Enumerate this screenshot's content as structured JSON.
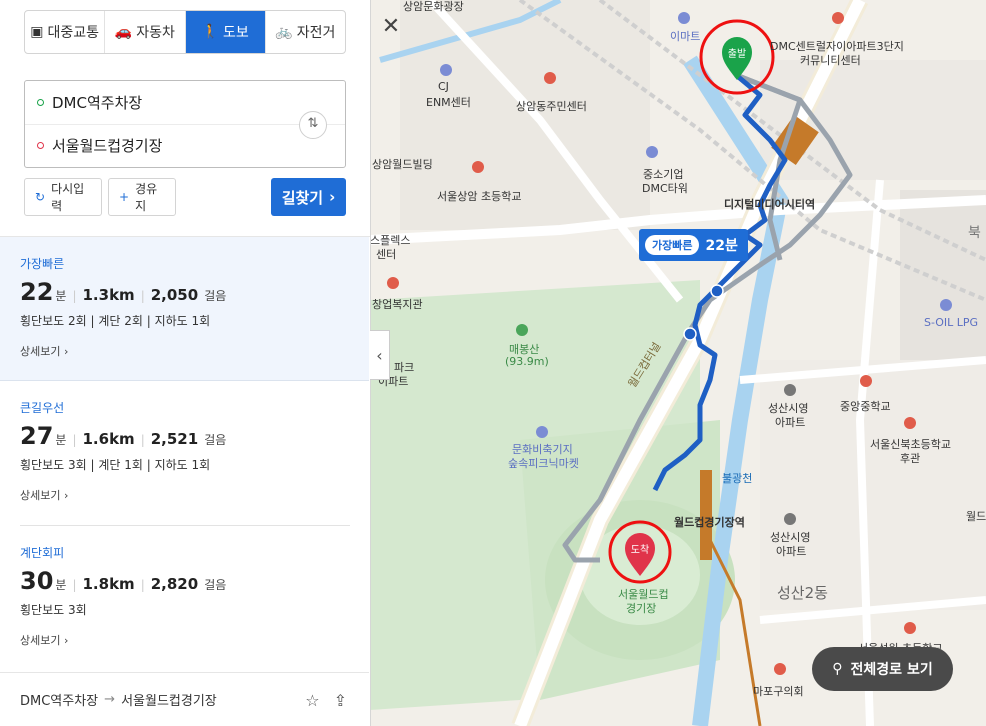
{
  "modes": [
    {
      "label": "대중교통",
      "icon": "bus-icon"
    },
    {
      "label": "자동차",
      "icon": "car-icon"
    },
    {
      "label": "도보",
      "icon": "walk-icon",
      "active": true
    },
    {
      "label": "자전거",
      "icon": "bicycle-icon"
    }
  ],
  "search": {
    "origin": "DMC역주차장",
    "destination": "서울월드컵경기장",
    "reset_label": "다시입력",
    "waypoint_label": "경유지",
    "go_label": "길찾기"
  },
  "routes": [
    {
      "label": "가장빠른",
      "minutes": "22",
      "min_unit": "분",
      "distance": "1.3km",
      "steps": "2,050",
      "steps_unit": "걸음",
      "detail": "횡단보도 2회 | 계단 2회 | 지하도 1회",
      "more": "상세보기 ›"
    },
    {
      "label": "큰길우선",
      "minutes": "27",
      "min_unit": "분",
      "distance": "1.6km",
      "steps": "2,521",
      "steps_unit": "걸음",
      "detail": "횡단보도 3회 | 계단 1회 | 지하도 1회",
      "more": "상세보기 ›"
    },
    {
      "label": "계단회피",
      "minutes": "30",
      "min_unit": "분",
      "distance": "1.8km",
      "steps": "2,820",
      "steps_unit": "걸음",
      "detail": "횡단보도 3회",
      "more": "상세보기 ›"
    }
  ],
  "bottom": {
    "from": "DMC역주차장",
    "arrow": "→",
    "to": "서울월드컵경기장"
  },
  "map": {
    "badge_tag": "가장빠른",
    "badge_value": "22분",
    "start_label": "출발",
    "end_label": "도착",
    "overview_label": "전체경로 보기",
    "labels": {
      "l_top": "상암문화광장",
      "l_emart": "이마트",
      "l_dmc_apt": "DMC센트럴자이아파트3단지",
      "l_dmc_apt2": "커뮤니티센터",
      "l_cj": "CJ",
      "l_cj2": "ENM센터",
      "l_sangam_center": "상암동주민센터",
      "l_bldg": "상암월드빌딩",
      "l_sme": "중소기업",
      "l_sme2": "DMC타워",
      "l_school": "서울상암 초등학교",
      "l_dmc_station": "디지털미디어시티역",
      "l_north": "북",
      "l_complex": "스플렉스",
      "l_complex2": "센터",
      "l_welfare": "창업복지관",
      "l_lpg": "S-OIL LPG",
      "l_park": "파크",
      "l_park2": "이파트",
      "l_maebong": "매봉산",
      "l_maebong2": "(93.9m)",
      "l_seongsan_apt": "성산시영",
      "l_seongsan_apt2": "아파트",
      "l_jungang": "중앙중학교",
      "l_seoul_sinbuk": "서울신북초등학교",
      "l_seoul_sinbuk2": "후관",
      "l_culture": "문화비축기지",
      "l_culture2": "숲속피크닉마켓",
      "l_bulgwang": "불광천",
      "l_worldcup_station": "월드컵경기장역",
      "l_seongsan_apt3": "성산시영",
      "l_seongsan_apt4": "아파트",
      "l_stadium": "서울월드컵",
      "l_stadium2": "경기장",
      "l_seongsan2": "성산2동",
      "l_seongwon": "서울성원 초등학교",
      "l_mapo": "마포구의회",
      "l_worldcup_road": "월드컵터널",
      "l_world2": "월드"
    }
  }
}
